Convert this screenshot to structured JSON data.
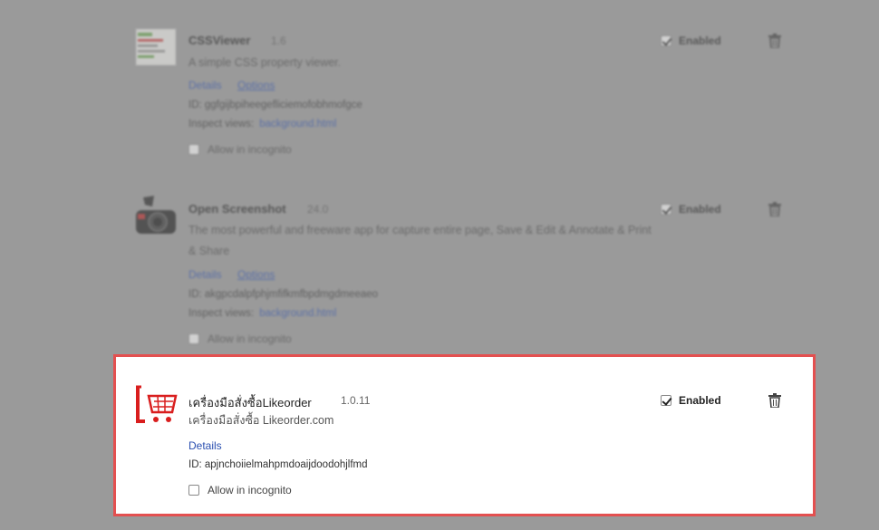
{
  "extensions": [
    {
      "name": "CSSViewer",
      "version": "1.6",
      "description": "A simple CSS property viewer.",
      "details_label": "Details",
      "options_label": "Options",
      "id_text": "ID: ggfgijbpiheegefliciemofobhmofgce",
      "inspect_label": "Inspect views:",
      "inspect_link": "background.html",
      "incognito_label": "Allow in incognito",
      "enabled_label": "Enabled",
      "enabled": true,
      "icon": "cssviewer-icon"
    },
    {
      "name": "Open Screenshot",
      "version": "24.0",
      "description": "The most powerful and freeware app for capture entire page, Save & Edit & Annotate & Print & Share",
      "details_label": "Details",
      "options_label": "Options",
      "id_text": "ID: akgpcdalpfphjmfifkmfbpdmgdmeeaeo",
      "inspect_label": "Inspect views:",
      "inspect_link": "background.html",
      "incognito_label": "Allow in incognito",
      "enabled_label": "Enabled",
      "enabled": true,
      "icon": "camera-icon"
    },
    {
      "name": "เครื่องมือสั่งซื้อLikeorder",
      "version": "1.0.11",
      "description": "เครื่องมือสั่งซื้อ Likeorder.com",
      "details_label": "Details",
      "id_text": "ID: apjnchoiielmahpmdoaijdoodohjlfmd",
      "incognito_label": "Allow in incognito",
      "enabled_label": "Enabled",
      "enabled": true,
      "icon": "shopping-cart-icon",
      "highlight_color": "#e35050"
    }
  ]
}
